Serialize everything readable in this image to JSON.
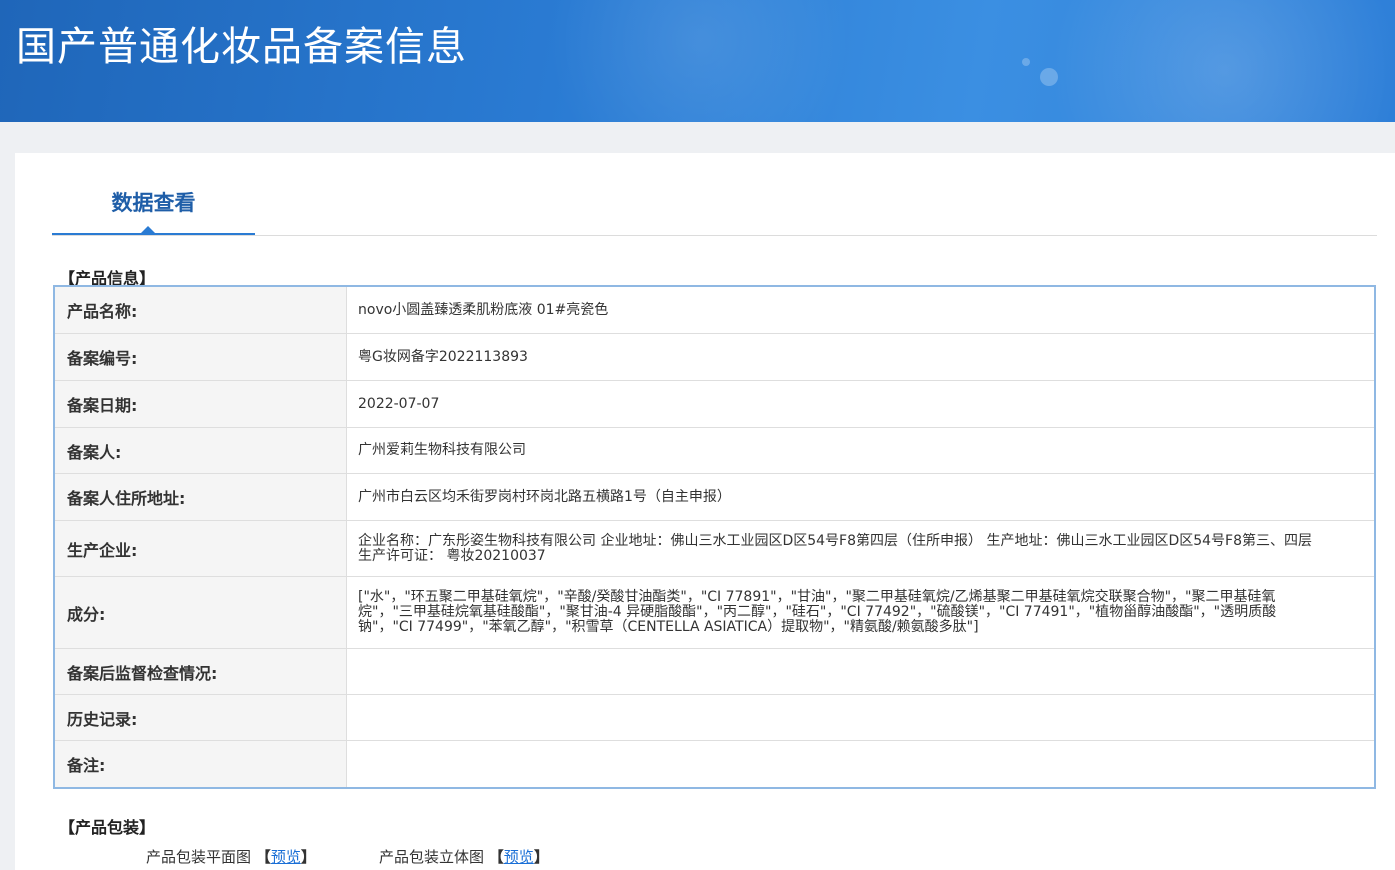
{
  "header": {
    "title": "国产普通化妆品备案信息"
  },
  "tabs": [
    {
      "label": "数据查看"
    }
  ],
  "product_section": {
    "title": "【产品信息】"
  },
  "product_info": [
    {
      "key": "产品名称:",
      "value": "novo小圆盖臻透柔肌粉底液 01#亮瓷色"
    },
    {
      "key": "备案编号:",
      "value": "粤G妆网备字2022113893"
    },
    {
      "key": "备案日期:",
      "value": "2022-07-07"
    },
    {
      "key": "备案人:",
      "value": "广州爱莉生物科技有限公司"
    },
    {
      "key": "备案人住所地址:",
      "value": "广州市白云区均禾街罗岗村环岗北路五横路1号（自主申报）"
    },
    {
      "key": "生产企业:",
      "value": "企业名称：广东彤姿生物科技有限公司 企业地址：佛山三水工业园区D区54号F8第四层（住所申报） 生产地址：佛山三水工业园区D区54号F8第三、四层 生产许可证：  粤妆20210037"
    },
    {
      "key": "成分:",
      "value": "[\"水\"，\"环五聚二甲基硅氧烷\"，\"辛酸/癸酸甘油酯类\"，\"CI 77891\"，\"甘油\"，\"聚二甲基硅氧烷/乙烯基聚二甲基硅氧烷交联聚合物\"，\"聚二甲基硅氧烷\"，\"三甲基硅烷氧基硅酸酯\"，\"聚甘油-4 异硬脂酸酯\"，\"丙二醇\"，\"硅石\"，\"CI 77492\"，\"硫酸镁\"，\"CI 77491\"，\"植物甾醇油酸酯\"，\"透明质酸钠\"，\"CI 77499\"，\"苯氧乙醇\"，\"积雪草（CENTELLA ASIATICA）提取物\"，\"精氨酸/赖氨酸多肽\"]"
    },
    {
      "key": "备案后监督检查情况:",
      "value": ""
    },
    {
      "key": "历史记录:",
      "value": ""
    },
    {
      "key": "备注:",
      "value": ""
    }
  ],
  "package_section": {
    "title": "【产品包装】",
    "items": [
      {
        "label": "产品包装平面图",
        "open": "【",
        "link": "预览",
        "close": "】"
      },
      {
        "label": "产品包装立体图 ",
        "open": "【",
        "link": "预览",
        "close": "】"
      }
    ]
  }
}
